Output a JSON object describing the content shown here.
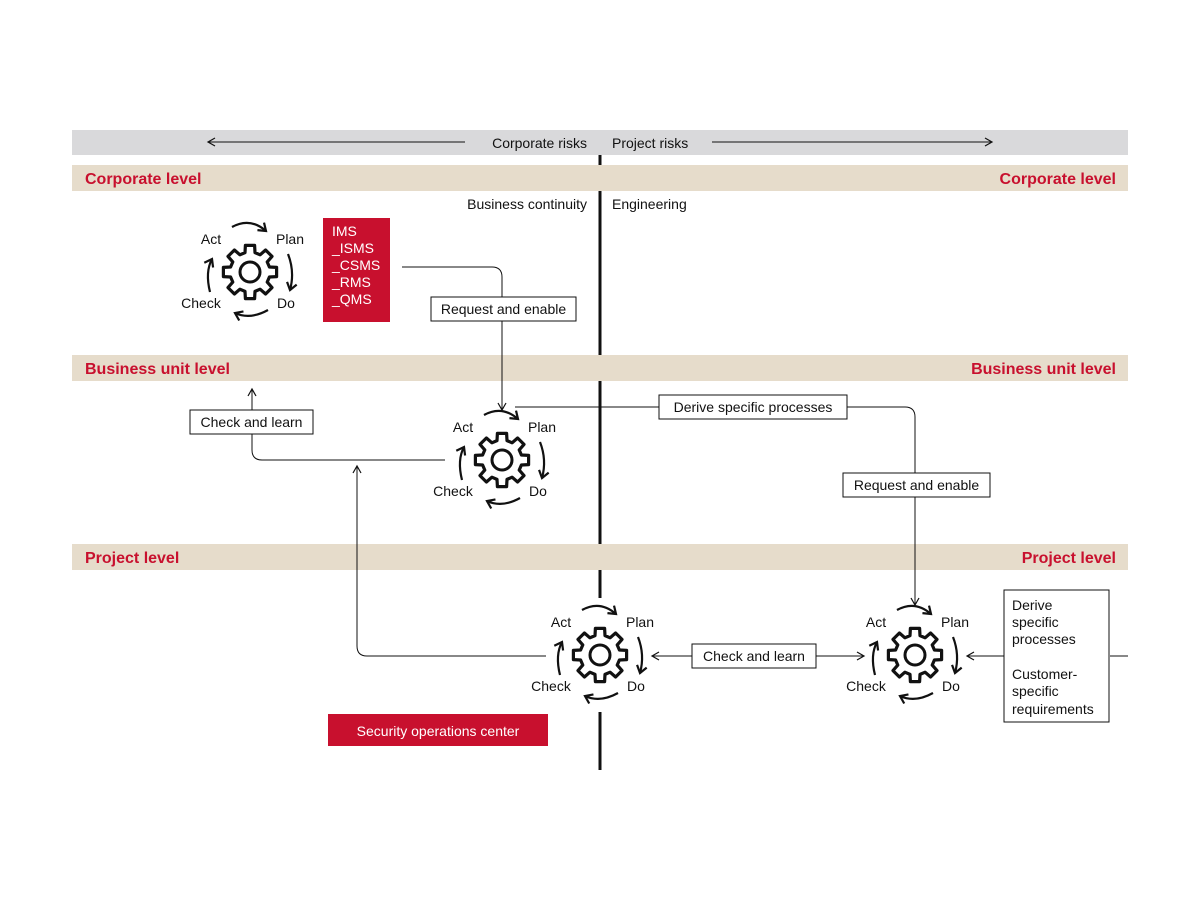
{
  "colors": {
    "accent": "#c8102e",
    "band": "#e6dccb",
    "header_band": "#d9d9db"
  },
  "header": {
    "left": "Corporate risks",
    "right": "Project risks"
  },
  "levels": {
    "corporate": {
      "left": "Corporate level",
      "right": "Corporate level"
    },
    "business_unit": {
      "left": "Business unit level",
      "right": "Business unit level"
    },
    "project": {
      "left": "Project level",
      "right": "Project level"
    }
  },
  "columns": {
    "left": "Business continuity",
    "right": "Engineering"
  },
  "pdca": {
    "act": "Act",
    "plan": "Plan",
    "do": "Do",
    "check": "Check"
  },
  "systems": [
    "IMS",
    "_ISMS",
    "_CSMS",
    "_RMS",
    "_QMS"
  ],
  "boxes": {
    "request_enable_1": "Request and enable",
    "check_learn_1": "Check and learn",
    "derive_processes": "Derive specific processes",
    "request_enable_2": "Request and enable",
    "check_learn_2": "Check and learn",
    "right_box": [
      "Derive",
      "specific",
      "processes",
      "",
      "Customer-",
      "specific",
      "requirements"
    ]
  },
  "soc": "Security operations center"
}
